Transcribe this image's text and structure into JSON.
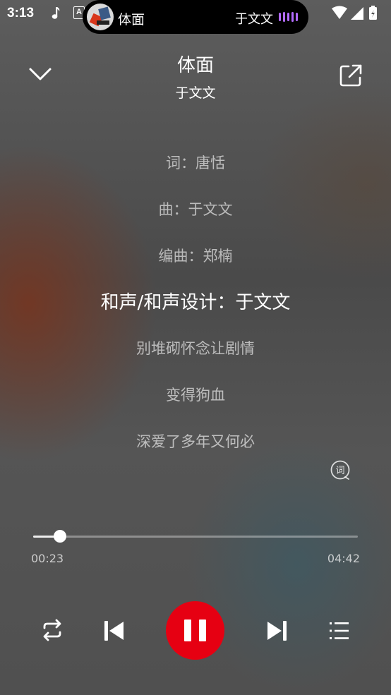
{
  "status_bar": {
    "time": "3:13",
    "a_badge": "A"
  },
  "island": {
    "title": "体面",
    "artist": "于文文",
    "accent": "#b26bff"
  },
  "header": {
    "title": "体面",
    "artist": "于文文"
  },
  "lyrics": {
    "lines": [
      "词：唐恬",
      "曲：于文文",
      "编曲：郑楠",
      "和声/和声设计：于文文",
      "别堆砌怀念让剧情",
      "变得狗血",
      "深爱了多年又何必"
    ],
    "active_index": 3
  },
  "progress": {
    "current": "00:23",
    "total": "04:42",
    "fraction": 0.082
  },
  "colors": {
    "play_button": "#e60012"
  },
  "icons": {
    "collapse": "chevron-down-icon",
    "share": "external-link-icon",
    "lyric_toggle": "lyric-icon",
    "repeat": "repeat-icon",
    "previous": "skip-previous-icon",
    "pause": "pause-icon",
    "next": "skip-next-icon",
    "playlist": "playlist-icon"
  },
  "lyric_icon_char": "词"
}
